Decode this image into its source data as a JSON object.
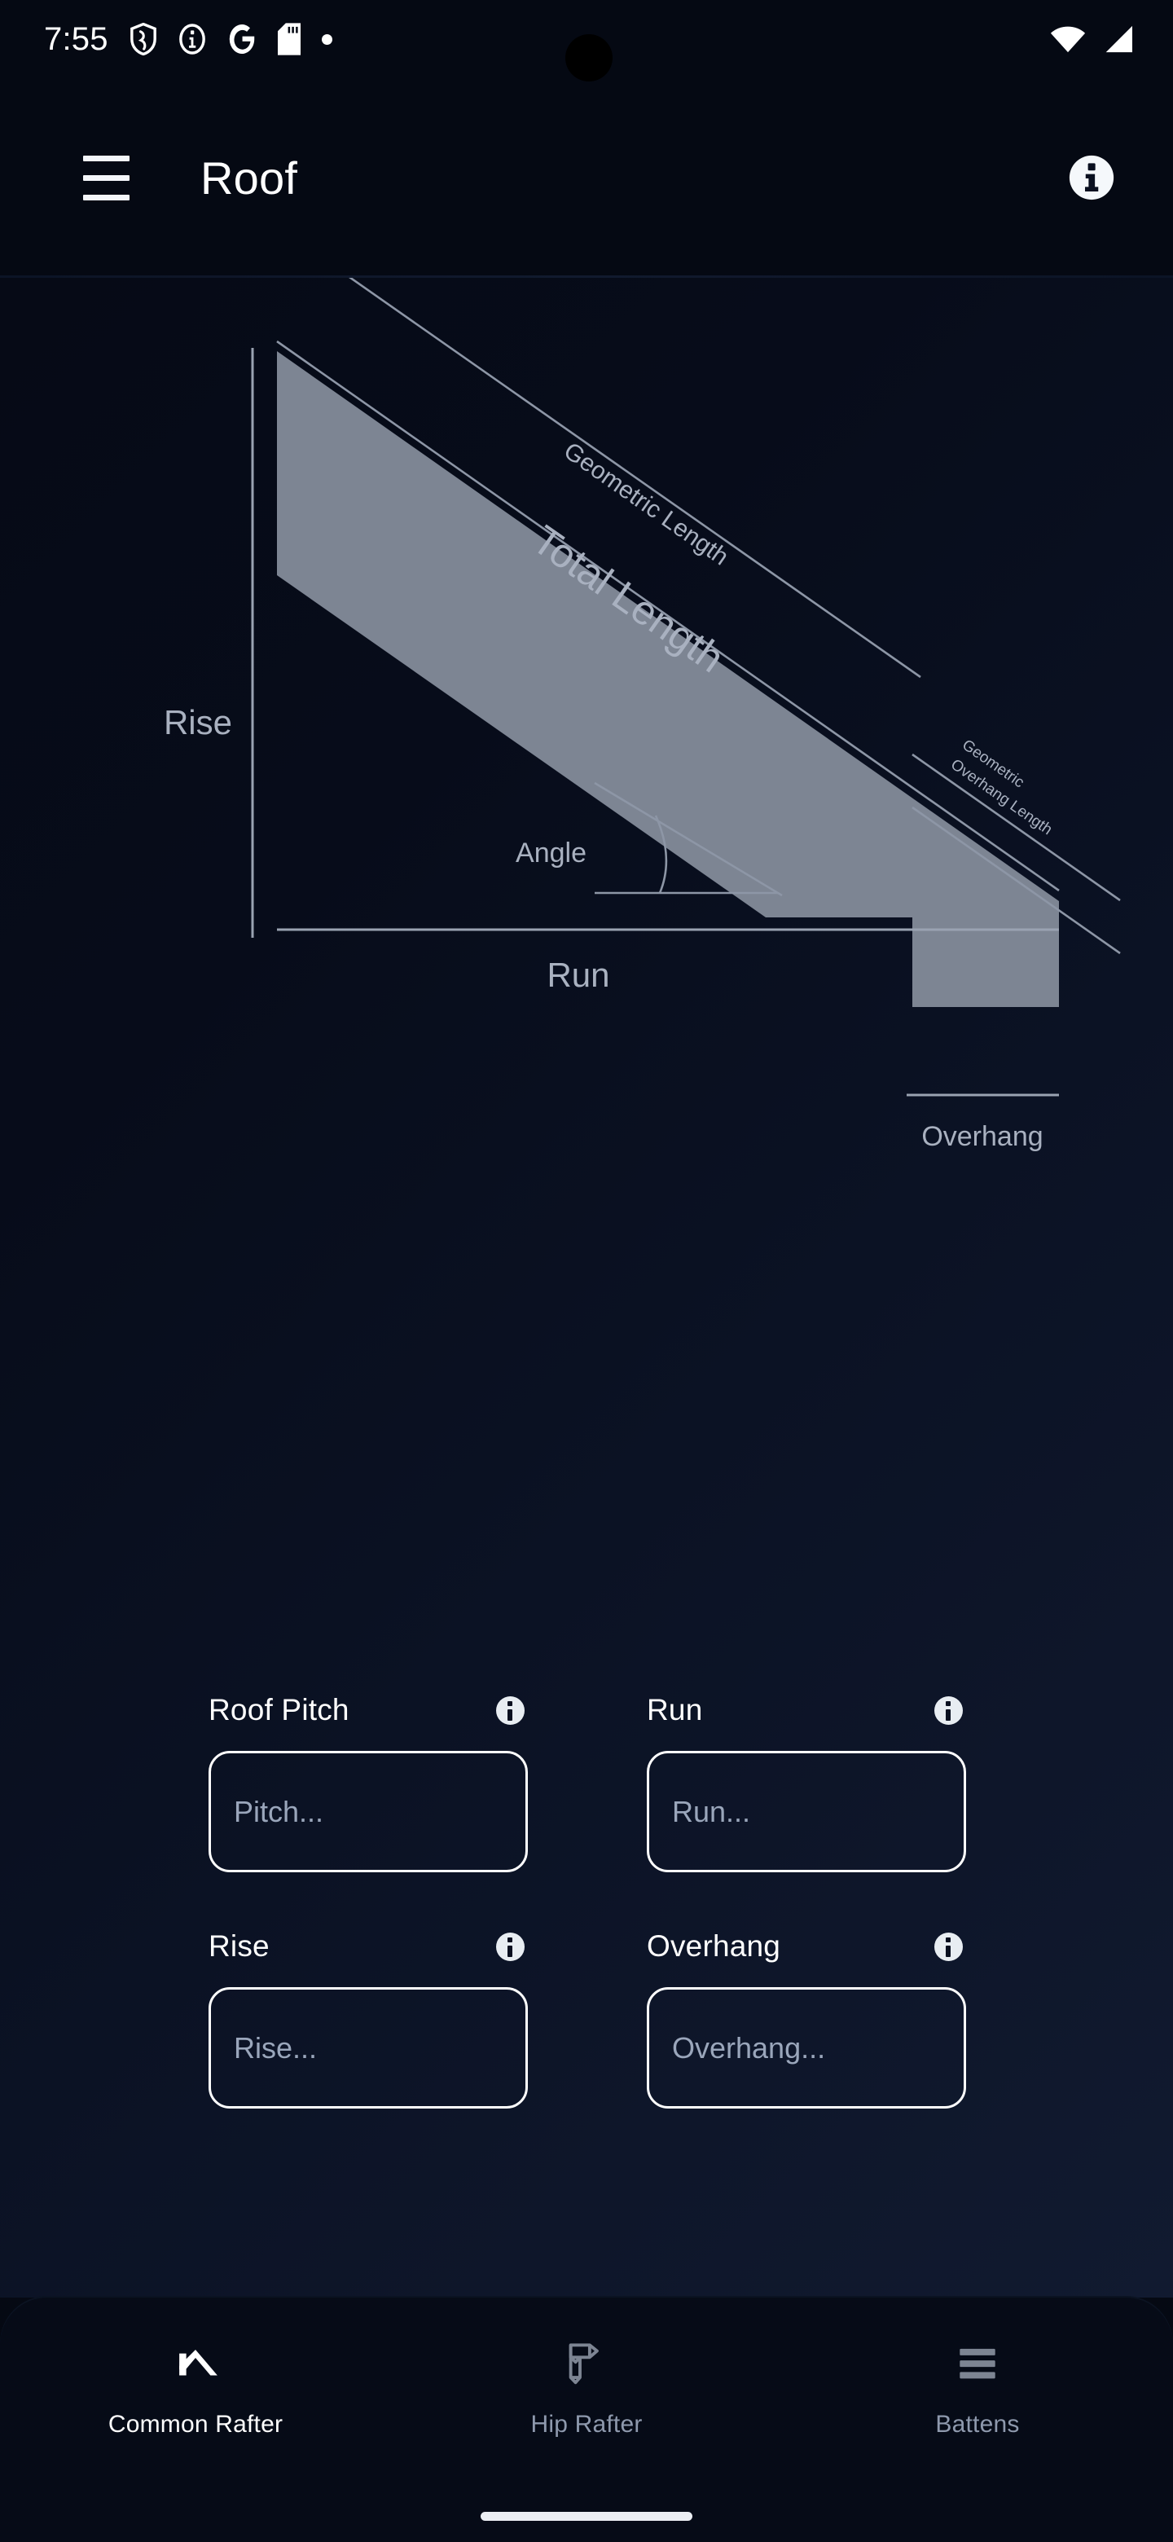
{
  "status_bar": {
    "time": "7:55",
    "left_icons": [
      "shield-icon",
      "info-circle-icon",
      "google-g-icon",
      "sd-card-icon",
      "dot-icon"
    ],
    "right_icons": [
      "wifi-icon",
      "cellular-signal-icon"
    ]
  },
  "app_bar": {
    "menu_icon": "hamburger-menu-icon",
    "title": "Roof",
    "info_icon": "info-circle-filled-icon"
  },
  "diagram": {
    "name": "common-rafter-diagram",
    "labels": {
      "geometric_length": "Geometric Length",
      "total_length": "Total Length",
      "geometric_overhang_line1": "Geometric",
      "geometric_overhang_line2": "Overhang Length",
      "rise": "Rise",
      "run": "Run",
      "angle": "Angle",
      "overhang": "Overhang"
    },
    "colors": {
      "rafter_fill": "#7d8593",
      "line": "#9aa3b2",
      "label_text": "#a9b1c0",
      "background_top": "#060a16",
      "background_bottom": "#111a30"
    }
  },
  "form": {
    "fields": [
      {
        "label": "Roof Pitch",
        "placeholder": "Pitch...",
        "value": "",
        "info_icon": "info-circle-filled-icon"
      },
      {
        "label": "Run",
        "placeholder": "Run...",
        "value": "",
        "info_icon": "info-circle-filled-icon"
      },
      {
        "label": "Rise",
        "placeholder": "Rise...",
        "value": "",
        "info_icon": "info-circle-filled-icon"
      },
      {
        "label": "Overhang",
        "placeholder": "Overhang...",
        "value": "",
        "info_icon": "info-circle-filled-icon"
      }
    ]
  },
  "bottom_nav": {
    "items": [
      {
        "label": "Common Rafter",
        "icon": "roof-chevron-icon",
        "active": true
      },
      {
        "label": "Hip Rafter",
        "icon": "hip-rafter-icon",
        "active": false
      },
      {
        "label": "Battens",
        "icon": "battens-lines-icon",
        "active": false
      }
    ],
    "active_color": "#ffffff",
    "inactive_color": "#8e99ad"
  }
}
